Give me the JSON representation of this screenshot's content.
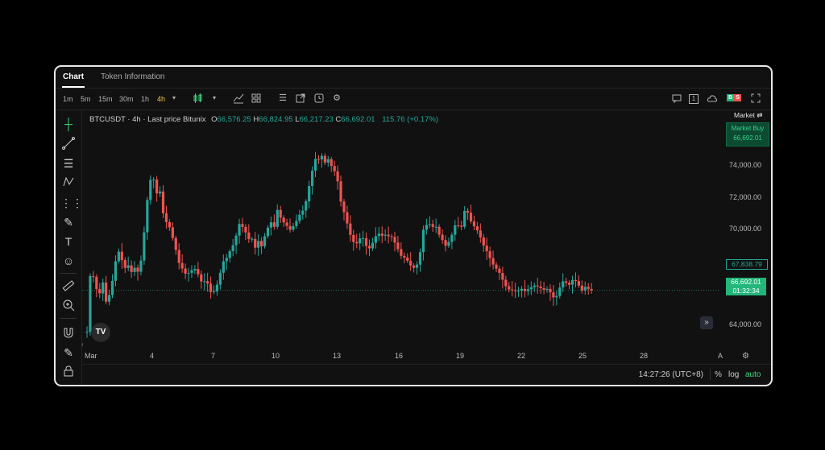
{
  "tabs": [
    {
      "label": "Chart",
      "active": true
    },
    {
      "label": "Token Information",
      "active": false
    }
  ],
  "toolbar": {
    "timeframes": [
      {
        "label": "1m",
        "active": false
      },
      {
        "label": "5m",
        "active": false
      },
      {
        "label": "15m",
        "active": false
      },
      {
        "label": "30m",
        "active": false
      },
      {
        "label": "1h",
        "active": false
      },
      {
        "label": "4h",
        "active": true
      }
    ],
    "icons": [
      "chevron-down-icon",
      "candles-icon",
      "chevron-down-icon",
      "indicators-icon",
      "layout-grid-icon",
      "list-icon",
      "expand-window-icon",
      "alarm-icon",
      "settings-icon",
      "chat-icon",
      "one-click-icon",
      "cloud-icon",
      "buy-sell-icon",
      "fullscreen-icon"
    ],
    "one_label": "1",
    "buy_sell_b": "B",
    "buy_sell_s": "S"
  },
  "legend": {
    "symbol": "BTCUSDT · 4h · Last price Bitunix",
    "o_label": "O",
    "o": "66,576.25",
    "h_label": "H",
    "h": "66,824.95",
    "l_label": "L",
    "l": "66,217.23",
    "c_label": "C",
    "c": "66,692.01",
    "change": "115.76 (+0.17%)"
  },
  "right_panel": {
    "market": "Market",
    "market_buy_label": "Market Buy",
    "market_buy_price": "66,692.01",
    "outline_tag": "67,838.79",
    "last_price_tag": "66,692.01",
    "countdown": "01:32:34"
  },
  "y_axis": [
    "74,000.00",
    "72,000.00",
    "70,000.00",
    "64,000.00"
  ],
  "x_axis": [
    "Mar",
    "4",
    "7",
    "10",
    "13",
    "16",
    "19",
    "22",
    "25",
    "28",
    "A"
  ],
  "bottom": {
    "clock": "14:27:26 (UTC+8)",
    "percent": "%",
    "log": "log",
    "auto": "auto"
  },
  "colors": {
    "up": "#26a69a",
    "down": "#ef5350",
    "accent_green": "#3ed67a",
    "timeframe_active": "#f2c94c"
  },
  "chart_data": {
    "type": "candlestick",
    "symbol": "BTCUSDT",
    "interval": "4h",
    "ylim": [
      63000,
      77500
    ],
    "y_ticks": [
      64000,
      70000,
      72000,
      74000
    ],
    "last_price": 66692.01,
    "path": [
      [
        0,
        64200
      ],
      [
        3,
        67300
      ],
      [
        5,
        67800
      ],
      [
        9,
        67400
      ],
      [
        11,
        66700
      ],
      [
        14,
        66900
      ],
      [
        16,
        66500
      ],
      [
        19,
        67500
      ],
      [
        21,
        66800
      ],
      [
        24,
        66000
      ],
      [
        27,
        66500
      ],
      [
        29,
        66300
      ],
      [
        33,
        67600
      ],
      [
        35,
        68200
      ],
      [
        39,
        69200
      ],
      [
        41,
        68800
      ],
      [
        45,
        68400
      ],
      [
        49,
        67900
      ],
      [
        53,
        68300
      ],
      [
        55,
        67700
      ],
      [
        59,
        68100
      ],
      [
        64,
        67800
      ],
      [
        67,
        68300
      ],
      [
        70,
        68900
      ],
      [
        74,
        71600
      ],
      [
        78,
        72700
      ],
      [
        81,
        73700
      ],
      [
        85,
        73200
      ],
      [
        87,
        72400
      ],
      [
        91,
        72900
      ],
      [
        95,
        71600
      ],
      [
        98,
        70600
      ],
      [
        101,
        70900
      ],
      [
        105,
        70300
      ],
      [
        111,
        69300
      ],
      [
        115,
        68400
      ],
      [
        121,
        67900
      ],
      [
        125,
        67600
      ],
      [
        129,
        67800
      ],
      [
        132,
        67900
      ],
      [
        137,
        68000
      ],
      [
        141,
        67500
      ],
      [
        145,
        67100
      ],
      [
        149,
        67300
      ],
      [
        153,
        67000
      ],
      [
        157,
        66400
      ],
      [
        163,
        66900
      ],
      [
        167,
        67600
      ],
      [
        171,
        68400
      ],
      [
        177,
        68700
      ],
      [
        181,
        69200
      ],
      [
        185,
        69500
      ],
      [
        189,
        70200
      ],
      [
        193,
        70900
      ],
      [
        197,
        70300
      ],
      [
        201,
        70100
      ],
      [
        205,
        69600
      ],
      [
        208,
        69800
      ],
      [
        212,
        69200
      ],
      [
        216,
        69700
      ],
      [
        220,
        69300
      ],
      [
        224,
        70000
      ],
      [
        228,
        70500
      ],
      [
        232,
        70800
      ],
      [
        235,
        70300
      ],
      [
        239,
        71600
      ],
      [
        243,
        71100
      ],
      [
        247,
        70800
      ],
      [
        251,
        70600
      ],
      [
        255,
        70300
      ],
      [
        259,
        70500
      ],
      [
        263,
        70800
      ],
      [
        267,
        71200
      ],
      [
        271,
        71400
      ],
      [
        276,
        72100
      ],
      [
        281,
        73300
      ],
      [
        285,
        74200
      ],
      [
        289,
        74800
      ],
      [
        292,
        74500
      ],
      [
        296,
        74800
      ],
      [
        300,
        74300
      ],
      [
        304,
        74600
      ],
      [
        308,
        74100
      ],
      [
        312,
        73800
      ],
      [
        315,
        73400
      ],
      [
        319,
        72100
      ],
      [
        322,
        71600
      ],
      [
        326,
        71000
      ],
      [
        330,
        70200
      ],
      [
        334,
        69700
      ],
      [
        338,
        69400
      ],
      [
        342,
        69700
      ],
      [
        346,
        70000
      ],
      [
        350,
        69500
      ],
      [
        354,
        69100
      ],
      [
        358,
        69400
      ],
      [
        362,
        69800
      ],
      [
        366,
        70200
      ],
      [
        370,
        69900
      ],
      [
        374,
        70100
      ],
      [
        378,
        69900
      ],
      [
        382,
        70000
      ],
      [
        386,
        69700
      ],
      [
        390,
        69300
      ],
      [
        393,
        69000
      ],
      [
        397,
        68600
      ],
      [
        401,
        68700
      ],
      [
        405,
        68300
      ],
      [
        409,
        68100
      ],
      [
        413,
        68000
      ],
      [
        418,
        68500
      ],
      [
        423,
        70300
      ],
      [
        427,
        70600
      ],
      [
        430,
        70800
      ],
      [
        434,
        70400
      ],
      [
        438,
        70700
      ],
      [
        442,
        70100
      ],
      [
        446,
        69900
      ],
      [
        450,
        69300
      ],
      [
        454,
        69500
      ],
      [
        458,
        69800
      ],
      [
        462,
        70500
      ],
      [
        466,
        70800
      ],
      [
        470,
        70100
      ],
      [
        474,
        71400
      ],
      [
        478,
        71600
      ],
      [
        481,
        71000
      ],
      [
        485,
        70700
      ],
      [
        489,
        70400
      ],
      [
        493,
        70200
      ],
      [
        497,
        69600
      ],
      [
        501,
        69200
      ],
      [
        505,
        68900
      ],
      [
        509,
        68400
      ],
      [
        513,
        68100
      ],
      [
        517,
        67900
      ],
      [
        521,
        67600
      ],
      [
        525,
        67100
      ],
      [
        529,
        66800
      ],
      [
        533,
        66700
      ],
      [
        537,
        66700
      ],
      [
        541,
        66600
      ],
      [
        544,
        66700
      ],
      [
        548,
        66800
      ],
      [
        552,
        66600
      ],
      [
        556,
        66800
      ],
      [
        560,
        66900
      ],
      [
        564,
        67000
      ],
      [
        568,
        66900
      ],
      [
        572,
        66800
      ],
      [
        576,
        66700
      ],
      [
        580,
        66800
      ],
      [
        584,
        66500
      ],
      [
        588,
        66200
      ],
      [
        592,
        66400
      ],
      [
        596,
        67000
      ],
      [
        600,
        67300
      ],
      [
        604,
        67100
      ],
      [
        608,
        67000
      ],
      [
        612,
        67400
      ],
      [
        616,
        67200
      ],
      [
        620,
        66900
      ],
      [
        624,
        66600
      ],
      [
        628,
        67000
      ],
      [
        632,
        66700
      ],
      [
        635,
        66692
      ]
    ]
  }
}
